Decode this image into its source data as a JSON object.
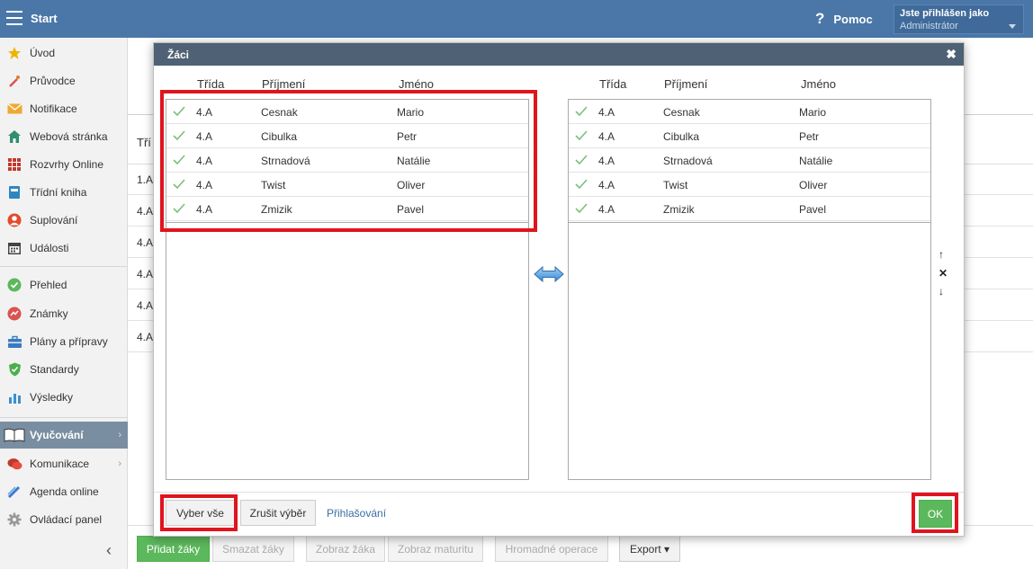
{
  "topbar": {
    "title": "Start",
    "help_label": "Pomoc",
    "help_glyph": "?",
    "user_line1": "Jste přihlášen jako",
    "user_line2": "Administrátor"
  },
  "sidebar": {
    "items": [
      {
        "label": "Úvod",
        "icon": "star-icon"
      },
      {
        "label": "Průvodce",
        "icon": "wand-icon"
      },
      {
        "label": "Notifikace",
        "icon": "envelope-icon"
      },
      {
        "label": "Webová stránka",
        "icon": "home-icon"
      },
      {
        "label": "Rozvrhy Online",
        "icon": "calendar-grid-icon"
      },
      {
        "label": "Třídní kniha",
        "icon": "book-icon"
      },
      {
        "label": "Suplování",
        "icon": "person-icon"
      },
      {
        "label": "Události",
        "icon": "calendar-icon"
      },
      {
        "label": "Přehled",
        "icon": "check-circle-icon"
      },
      {
        "label": "Známky",
        "icon": "grade-icon"
      },
      {
        "label": "Plány a přípravy",
        "icon": "briefcase-icon"
      },
      {
        "label": "Standardy",
        "icon": "shield-icon"
      },
      {
        "label": "Výsledky",
        "icon": "bar-chart-icon"
      },
      {
        "label": "Vyučování",
        "icon": "open-book-icon"
      },
      {
        "label": "Komunikace",
        "icon": "chat-icon"
      },
      {
        "label": "Agenda online",
        "icon": "pen-icon"
      },
      {
        "label": "Ovládací panel",
        "icon": "gear-icon"
      }
    ],
    "arrow": "›",
    "collapse": "‹"
  },
  "background": {
    "header_text": "Tří",
    "rows": [
      "1.A",
      "4.A",
      "4.A",
      "4.A",
      "4.A",
      "4.A"
    ]
  },
  "bottom_buttons": {
    "add": "Přidat žáky",
    "delete": "Smazat žáky",
    "show_student": "Zobraz žáka",
    "show_exam": "Zobraz maturitu",
    "bulk": "Hromadné operace",
    "export": "Export ▾"
  },
  "dialog": {
    "title": "Žáci",
    "close": "✖",
    "columns": {
      "class": "Třída",
      "surname": "Příjmení",
      "name": "Jméno"
    },
    "left_rows": [
      {
        "class": "4.A",
        "surname": "Cesnak",
        "name": "Mario"
      },
      {
        "class": "4.A",
        "surname": "Cibulka",
        "name": "Petr"
      },
      {
        "class": "4.A",
        "surname": "Strnadová",
        "name": "Natálie"
      },
      {
        "class": "4.A",
        "surname": "Twist",
        "name": "Oliver"
      },
      {
        "class": "4.A",
        "surname": "Zmizik",
        "name": "Pavel"
      }
    ],
    "right_rows": [
      {
        "class": "4.A",
        "surname": "Cesnak",
        "name": "Mario"
      },
      {
        "class": "4.A",
        "surname": "Cibulka",
        "name": "Petr"
      },
      {
        "class": "4.A",
        "surname": "Strnadová",
        "name": "Natálie"
      },
      {
        "class": "4.A",
        "surname": "Twist",
        "name": "Oliver"
      },
      {
        "class": "4.A",
        "surname": "Zmizik",
        "name": "Pavel"
      }
    ],
    "controls": {
      "up": "↑",
      "remove": "✕",
      "down": "↓"
    },
    "select_all": "Vyber vše",
    "cancel_selection": "Zrušit výběr",
    "logins_link": "Přihlašování",
    "ok": "OK"
  },
  "colors": {
    "topbar": "#4a77a8",
    "dialog_title": "#4f6174",
    "ok_green": "#5cb85c",
    "highlight_red": "#e0141e",
    "check_green": "#7cbf7c"
  }
}
